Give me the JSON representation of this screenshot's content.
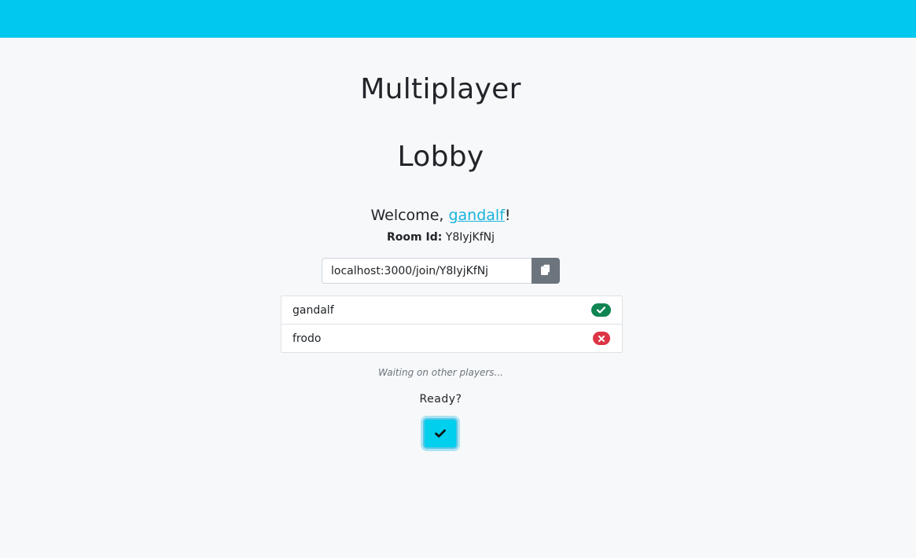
{
  "header": {
    "color": "#00c8ee"
  },
  "page": {
    "title_line1": "Multiplayer",
    "title_line2": "Lobby"
  },
  "welcome": {
    "prefix": "Welcome, ",
    "username": "gandalf",
    "suffix": "!"
  },
  "room": {
    "label": "Room Id:",
    "id": "Y8IyjKfNj"
  },
  "invite": {
    "link_value": "localhost:3000/join/Y8IyjKfNj",
    "copy_icon": "copy-icon"
  },
  "players": [
    {
      "name": "gandalf",
      "ready": true,
      "status_icon": "check-icon",
      "status_color": "#0f8552"
    },
    {
      "name": "frodo",
      "ready": false,
      "status_icon": "x-icon",
      "status_color": "#dc3545"
    }
  ],
  "status_text": "Waiting on other players...",
  "ready": {
    "label": "Ready?",
    "button_icon": "check-icon",
    "button_color": "#00cfee"
  }
}
